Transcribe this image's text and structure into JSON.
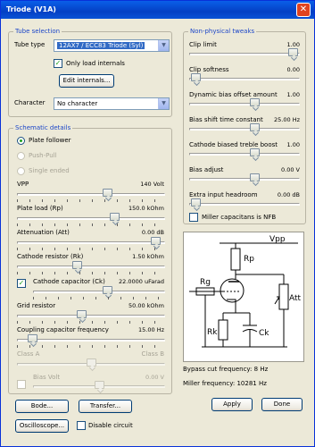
{
  "window": {
    "title": "Triode (V1A)",
    "close_label": "✕"
  },
  "tube_selection": {
    "group_title": "Tube selection",
    "tube_type_label": "Tube type",
    "tube_type_value": "12AX7 / ECC83 Triode (Syl)",
    "only_load_internals_label": "Only load internals",
    "only_load_internals_checked": true,
    "edit_internals_label": "Edit internals...",
    "character_label": "Character",
    "character_value": "No character"
  },
  "schematic_details": {
    "group_title": "Schematic details",
    "radios": [
      {
        "label": "Plate follower",
        "selected": true,
        "enabled": true
      },
      {
        "label": "Push-Pull",
        "selected": false,
        "enabled": false
      },
      {
        "label": "Single ended",
        "selected": false,
        "enabled": false
      }
    ],
    "sliders": [
      {
        "label": "VPP",
        "value": "140 Volt",
        "level": 0.62,
        "enabled": true
      },
      {
        "label": "Plate load (Rp)",
        "value": "150.0 kOhm",
        "level": 0.67,
        "enabled": true
      },
      {
        "label": "Attenuation (Att)",
        "value": "0.00 dB",
        "level": 0.97,
        "enabled": true
      },
      {
        "label": "Cathode resistor (Rk)",
        "value": "1.50 kOhm",
        "level": 0.4,
        "enabled": true
      },
      {
        "label": "Cathode capacitor (Ck)",
        "value": "22.0000 uFarad",
        "level": 0.57,
        "enabled": true,
        "checked": true
      },
      {
        "label": "Grid resistor",
        "value": "50.00 kOhm",
        "level": 0.43,
        "enabled": true
      },
      {
        "label": "Coupling capacitor frequency",
        "value": "15.00 Hz",
        "level": 0.08,
        "enabled": true
      }
    ],
    "class_a_label": "Class A",
    "class_b_label": "Class B",
    "class_slider_level": 0.5,
    "bias_volt_label": "Bias Volt",
    "bias_volt_value": "0.00 V",
    "bias_volt_level": 0.5
  },
  "non_physical": {
    "group_title": "Non-physical tweaks",
    "sliders": [
      {
        "label": "Clip limit",
        "value": "1.00",
        "level": 0.98
      },
      {
        "label": "Clip softness",
        "value": "0.00",
        "level": 0.02
      },
      {
        "label": "Dynamic bias offset amount",
        "value": "1.00",
        "level": 0.6
      },
      {
        "label": "Bias shift time constant",
        "value": "25.00 Hz",
        "level": 0.6
      },
      {
        "label": "Cathode biased treble boost",
        "value": "1.00",
        "level": 0.6
      },
      {
        "label": "Bias adjust",
        "value": "0.00 V",
        "level": 0.6
      },
      {
        "label": "Extra input headroom",
        "value": "0.00 dB",
        "level": 0.02
      }
    ],
    "miller_label": "Miller capacitans is NFB",
    "miller_checked": false
  },
  "schematic": {
    "vpp_label": "Vpp",
    "rp_label": "Rp",
    "rg_label": "Rg",
    "att_label": "Att",
    "rk_label": "Rk",
    "ck_label": "Ck"
  },
  "info": {
    "bypass_cut": "Bypass cut frequency: 8 Hz",
    "miller_freq": "Miller frequency: 10281 Hz"
  },
  "buttons": {
    "bode": "Bode...",
    "transfer": "Transfer...",
    "oscilloscope": "Oscilloscope...",
    "disable_circuit": "Disable circuit",
    "apply": "Apply",
    "done": "Done"
  },
  "colors": {
    "accent": "#1c46c8",
    "title_bar": "#0a53d6",
    "window_bg": "#ece9d8"
  }
}
